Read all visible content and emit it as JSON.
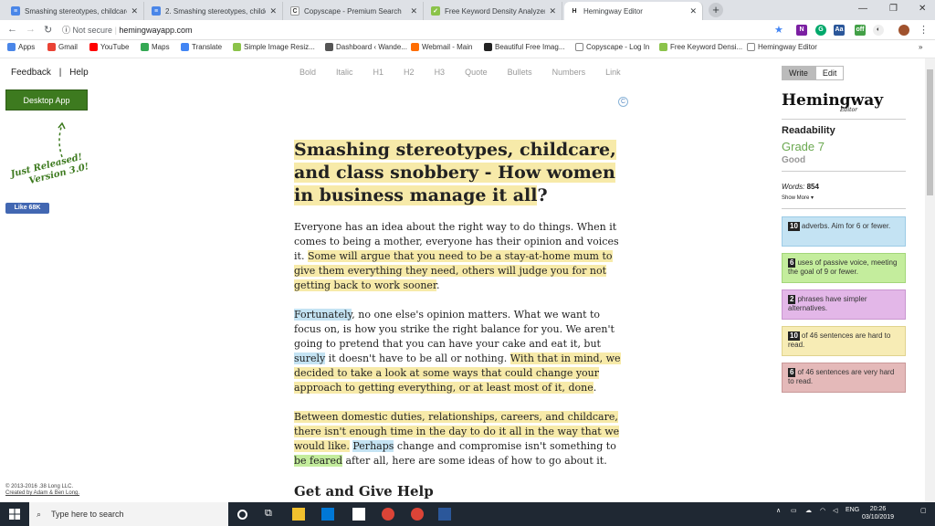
{
  "browser": {
    "tabs": [
      {
        "title": "Smashing stereotypes, childcare...",
        "color": "#4a86e8",
        "fav": "≡"
      },
      {
        "title": "2. Smashing stereotypes, childca...",
        "color": "#4a86e8",
        "fav": "≡"
      },
      {
        "title": "Copyscape - Premium Search",
        "color": "#ffffff",
        "fav": "C"
      },
      {
        "title": "Free Keyword Density Analyzer T...",
        "color": "#8bc34a",
        "fav": "✓"
      },
      {
        "title": "Hemingway Editor",
        "color": "#ffffff",
        "fav": "H"
      }
    ],
    "address": {
      "security": "Not secure",
      "url": "hemingwayapp.com"
    },
    "bookmarks": [
      {
        "label": "Apps",
        "color": "#4a86e8"
      },
      {
        "label": "Gmail",
        "color": "#ea4335"
      },
      {
        "label": "YouTube",
        "color": "#ff0000"
      },
      {
        "label": "Maps",
        "color": "#34a853"
      },
      {
        "label": "Translate",
        "color": "#4285f4"
      },
      {
        "label": "Simple Image Resiz...",
        "color": "#8bc34a"
      },
      {
        "label": "Dashboard ‹ Wande...",
        "color": "#555555"
      },
      {
        "label": "Webmail - Main",
        "color": "#ff6d00"
      },
      {
        "label": "Beautiful Free Imag...",
        "color": "#222222"
      },
      {
        "label": "Copyscape - Log In",
        "color": "#ffffff"
      },
      {
        "label": "Free Keyword Densi...",
        "color": "#8bc34a"
      },
      {
        "label": "Hemingway Editor",
        "color": "#ffffff"
      }
    ]
  },
  "left": {
    "feedback": "Feedback",
    "separator": "|",
    "help": "Help",
    "desktop_app": "Desktop App",
    "released_line1": "Just Released!",
    "released_line2": "Version 3.0!",
    "like": "Like 68K",
    "copyright1": "© 2013-2016 .38 Long LLC.",
    "copyright2": "Created by Adam & Ben Long."
  },
  "toolbar": [
    "Bold",
    "Italic",
    "H1",
    "H2",
    "H3",
    "Quote",
    "Bullets",
    "Numbers",
    "Link"
  ],
  "editor": {
    "title_main": "Smashing stereotypes, childcare, and class snobbery - How women in business manage it all",
    "title_end": "?",
    "p1a": "Everyone has an idea about the right way to do things. When it comes to being a mother, everyone has their opinion and voices it.",
    "p1b": "Some will argue that you need to be a stay-at-home mum to give them everything they need, others will judge you for not getting back to work sooner",
    "p1c": ".",
    "p2a": "Fortunately",
    "p2b": ", no one else's opinion matters. What we want to focus on, is how you strike the right balance for you. We aren't going to pretend that you can have your cake and eat it, but",
    "p2c": "surely",
    "p2d": "it doesn't have to be all or nothing.",
    "p2e": "With that in mind, we decided to take a look at some ways that could change your approach to getting everything, or at least most of it, done",
    "p2f": ".",
    "p3a": "Between domestic duties, relationships, careers, and childcare, there isn't enough time in the day to do it all in the way that we would like.",
    "p3b": "Perhaps",
    "p3c": "change and compromise isn't something to",
    "p3d": "be feared",
    "p3e": "after all, here are some ideas of how to go about it.",
    "h2": "Get and Give Help"
  },
  "sidebar": {
    "write": "Write",
    "edit": "Edit",
    "logo": "Hemingway",
    "logo_sub": "Editor",
    "readability": "Readability",
    "grade": "Grade 7",
    "grade_word": "Good",
    "words_label": "Words:",
    "words_count": "854",
    "show_more": "Show More ▾",
    "cards": [
      {
        "count": "10",
        "text": "adverbs. Aim for 6 or fewer."
      },
      {
        "count": "6",
        "text": "uses of passive voice, meeting the goal of 9 or fewer."
      },
      {
        "count": "2",
        "text": "phrases have simpler alternatives."
      },
      {
        "count": "10",
        "text": "of 46 sentences are hard to read."
      },
      {
        "count": "6",
        "text": "of 46 sentences are very hard to read."
      }
    ]
  },
  "taskbar": {
    "search_placeholder": "Type here to search",
    "lang": "ENG",
    "time": "20:26",
    "date": "03/10/2019"
  }
}
